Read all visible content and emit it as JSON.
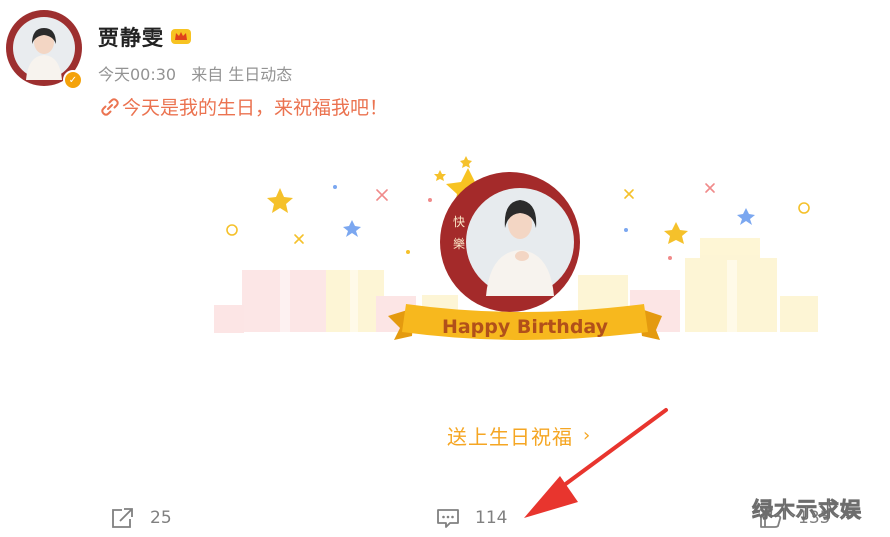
{
  "post": {
    "user": {
      "name": "贾静雯"
    },
    "meta": {
      "time": "今天00:30",
      "source": "来自 生日动态"
    },
    "text": "今天是我的生日，来祝福我吧！"
  },
  "card": {
    "vertical_text": "快樂",
    "banner_text": "Happy Birthday",
    "action_label": "送上生日祝福",
    "action_chevron": "›"
  },
  "actions": {
    "share_count": "25",
    "comment_count": "114",
    "like_count": "135"
  },
  "watermark": "绿木示求娱",
  "colors": {
    "accent": "#eb7350",
    "bless": "#f5a623",
    "banner": "#f7b81e",
    "card_red": "#a42a2a",
    "arrow": "#e8352e"
  }
}
